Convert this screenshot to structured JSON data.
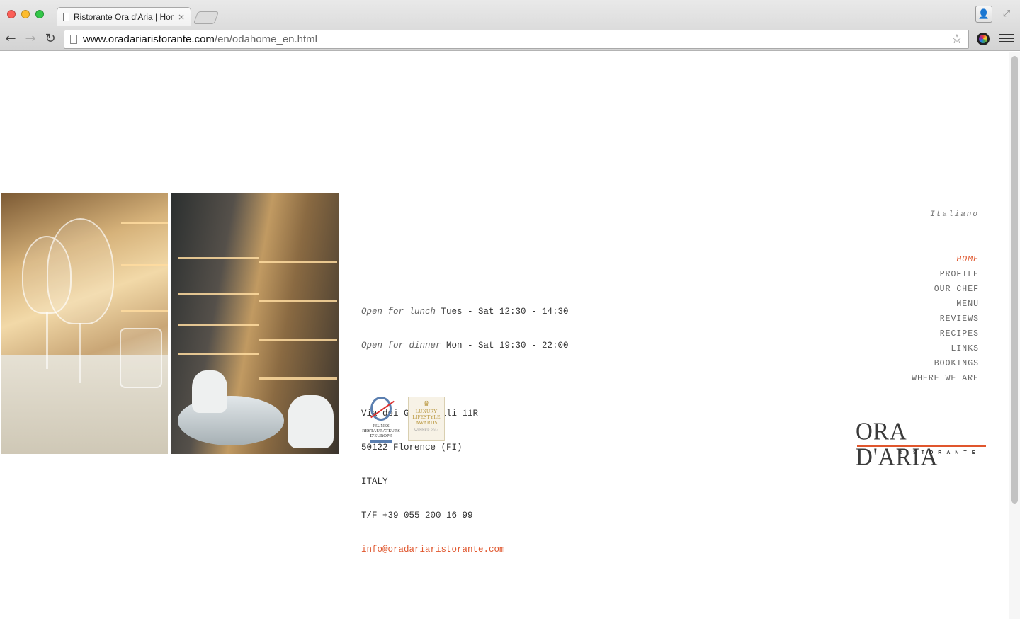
{
  "browser": {
    "tab_title": "Ristorante Ora d'Aria | Home",
    "tab_close": "×",
    "url_host": "www.oradariaristorante.com",
    "url_path": "/en/odahome_en.html",
    "icons": [
      "back-arrow-icon",
      "forward-arrow-icon",
      "reload-icon",
      "page-icon",
      "star-icon",
      "profile-icon",
      "fullscreen-icon",
      "extension-icon",
      "menu-icon"
    ]
  },
  "hours": {
    "lunch_label": "Open for lunch",
    "lunch_time": " Tues - Sat 12:30 - 14:30",
    "dinner_label": "Open for dinner",
    "dinner_time": " Mon - Sat 19:30 - 22:00"
  },
  "address": {
    "street": "Via dei Georgofili 11R",
    "city": "50122 Florence (FI)",
    "country": "ITALY",
    "phone": "T/F +39 055 200 16 99",
    "email": "info@oradariaristorante.com"
  },
  "badges": {
    "jre": "JEUNES RESTAURATEURS D'EUROPE",
    "lla_title": "LUXURY LIFESTYLE AWARDS",
    "lla_sub": "WINNER 2014"
  },
  "language_link": "Italiano",
  "nav": [
    {
      "label": "HOME",
      "active": true
    },
    {
      "label": "PROFILE"
    },
    {
      "label": "OUR CHEF"
    },
    {
      "label": "MENU"
    },
    {
      "label": "REVIEWS"
    },
    {
      "label": "RECIPES"
    },
    {
      "label": "LINKS"
    },
    {
      "label": "BOOKINGS"
    },
    {
      "label": "WHERE WE ARE"
    }
  ],
  "logo": {
    "main": "ORA D'ARIA",
    "sub": "RISTORANTE"
  },
  "colors": {
    "accent": "#e0562d",
    "text": "#333333"
  }
}
